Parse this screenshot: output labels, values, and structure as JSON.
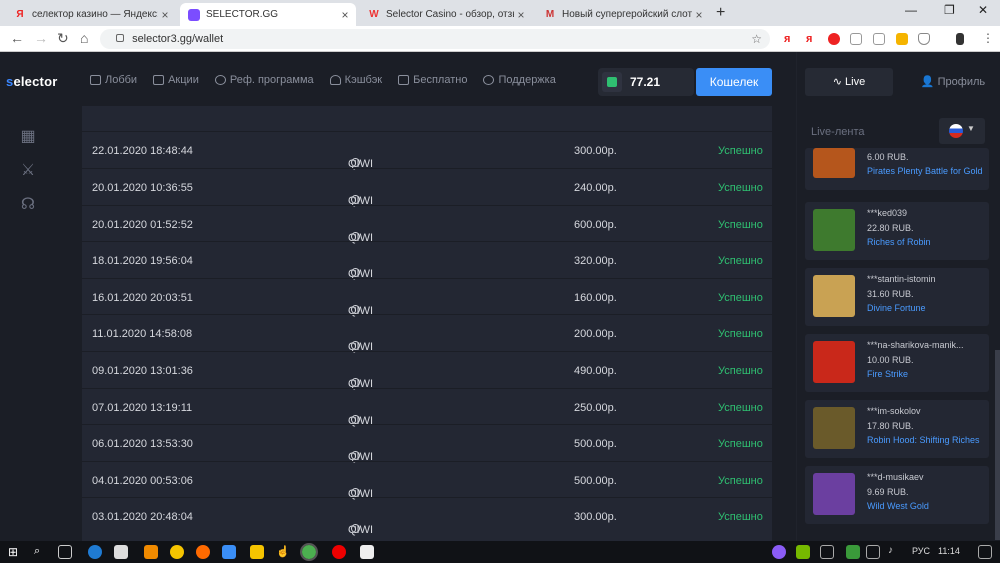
{
  "browser": {
    "tabs": [
      {
        "title": "селектор казино — Яндекс: нашл",
        "icon": "yandex-icon",
        "color": "#e22"
      },
      {
        "title": "SELECTOR.GG",
        "icon": "selector-icon",
        "color": "#7b4dff"
      },
      {
        "title": "Selector Casino - обзор, отзывы",
        "icon": "w-icon",
        "color": "#e33"
      },
      {
        "title": "Новый супергеройский слот! - с",
        "icon": "gmail-icon",
        "color": "#c33"
      }
    ],
    "url": "selector3.gg/wallet",
    "new_tab": "+",
    "close_glyph": "×"
  },
  "app": {
    "logo_prefix": "s",
    "logo_rest": "elector",
    "nav": [
      {
        "label": "Лобби",
        "icon": "lobby-icon"
      },
      {
        "label": "Акции",
        "icon": "gift-icon"
      },
      {
        "label": "Реф. программа",
        "icon": "referral-icon"
      },
      {
        "label": "Кэшбэк",
        "icon": "cashback-icon"
      },
      {
        "label": "Бесплатно",
        "icon": "free-icon"
      },
      {
        "label": "Поддержка",
        "icon": "support-icon"
      }
    ],
    "balance": "77.21",
    "wallet_button": "Кошелек"
  },
  "transactions": [
    {
      "date": "22.01.2020 18:48:44",
      "method": "QIWI",
      "amount": "300.00р.",
      "status": "Успешно"
    },
    {
      "date": "20.01.2020 10:36:55",
      "method": "QIWI",
      "amount": "240.00р.",
      "status": "Успешно"
    },
    {
      "date": "20.01.2020 01:52:52",
      "method": "QIWI",
      "amount": "600.00р.",
      "status": "Успешно"
    },
    {
      "date": "18.01.2020 19:56:04",
      "method": "QIWI",
      "amount": "320.00р.",
      "status": "Успешно"
    },
    {
      "date": "16.01.2020 20:03:51",
      "method": "QIWI",
      "amount": "160.00р.",
      "status": "Успешно"
    },
    {
      "date": "11.01.2020 14:58:08",
      "method": "QIWI",
      "amount": "200.00р.",
      "status": "Успешно"
    },
    {
      "date": "09.01.2020 13:01:36",
      "method": "QIWI",
      "amount": "490.00р.",
      "status": "Успешно"
    },
    {
      "date": "07.01.2020 13:19:11",
      "method": "QIWI",
      "amount": "250.00р.",
      "status": "Успешно"
    },
    {
      "date": "06.01.2020 13:53:30",
      "method": "QIWI",
      "amount": "500.00р.",
      "status": "Успешно"
    },
    {
      "date": "04.01.2020 00:53:06",
      "method": "QIWI",
      "amount": "500.00р.",
      "status": "Успешно"
    },
    {
      "date": "03.01.2020 20:48:04",
      "method": "QIWI",
      "amount": "300.00р.",
      "status": "Успешно"
    }
  ],
  "right_panel": {
    "live_tab": "Live",
    "profile_tab": "Профиль",
    "feed_title": "Live-лента",
    "feed": [
      {
        "user": "",
        "sum": "6.00 RUB.",
        "game": "Pirates Plenty Battle for Gold",
        "color": "#b5561c"
      },
      {
        "user": "***ked039",
        "sum": "22.80 RUB.",
        "game": "Riches of Robin",
        "color": "#3e7a2e"
      },
      {
        "user": "***stantin-istomin",
        "sum": "31.60 RUB.",
        "game": "Divine Fortune",
        "color": "#c9a253"
      },
      {
        "user": "***na-sharikova-manik...",
        "sum": "10.00 RUB.",
        "game": "Fire Strike",
        "color": "#c9281a"
      },
      {
        "user": "***im-sokolov",
        "sum": "17.80 RUB.",
        "game": "Robin Hood: Shifting Riches",
        "color": "#6a5a2a"
      },
      {
        "user": "***d-musikaev",
        "sum": "9.69 RUB.",
        "game": "Wild West Gold",
        "color": "#6b3fa0"
      }
    ]
  },
  "taskbar": {
    "lang": "РУС",
    "time": "11:14"
  }
}
